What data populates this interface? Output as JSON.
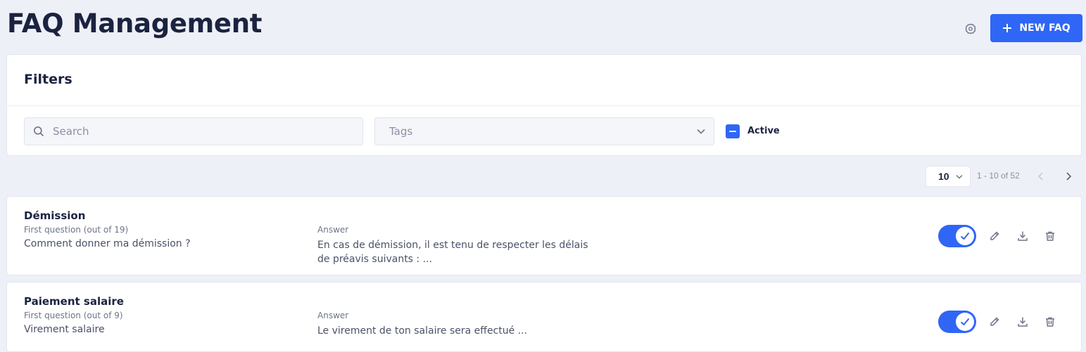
{
  "header": {
    "title": "FAQ Management",
    "new_button_label": "NEW FAQ",
    "settings_icon": "gear-icon"
  },
  "filters": {
    "title": "Filters",
    "search": {
      "placeholder": "Search",
      "value": ""
    },
    "tags": {
      "placeholder": "Tags"
    },
    "active": {
      "label": "Active",
      "state": "indeterminate"
    }
  },
  "pagination": {
    "page_size": "10",
    "range_text": "1 - 10 of 52"
  },
  "faqs": [
    {
      "title": "Démission",
      "subtitle": "First question (out of 19)",
      "question": "Comment donner ma démission ?",
      "answer_label": "Answer",
      "answer": "En cas de démission, il est tenu de respecter les délais de préavis suivants : ...",
      "active": true
    },
    {
      "title": "Paiement salaire",
      "subtitle": "First question (out of 9)",
      "question": "Virement salaire",
      "answer_label": "Answer",
      "answer": "Le virement de ton salaire sera effectué ...",
      "active": true
    }
  ],
  "colors": {
    "accent": "#2f66f6",
    "background": "#eef0f7",
    "title": "#1b2340",
    "muted": "#8a91a5"
  }
}
